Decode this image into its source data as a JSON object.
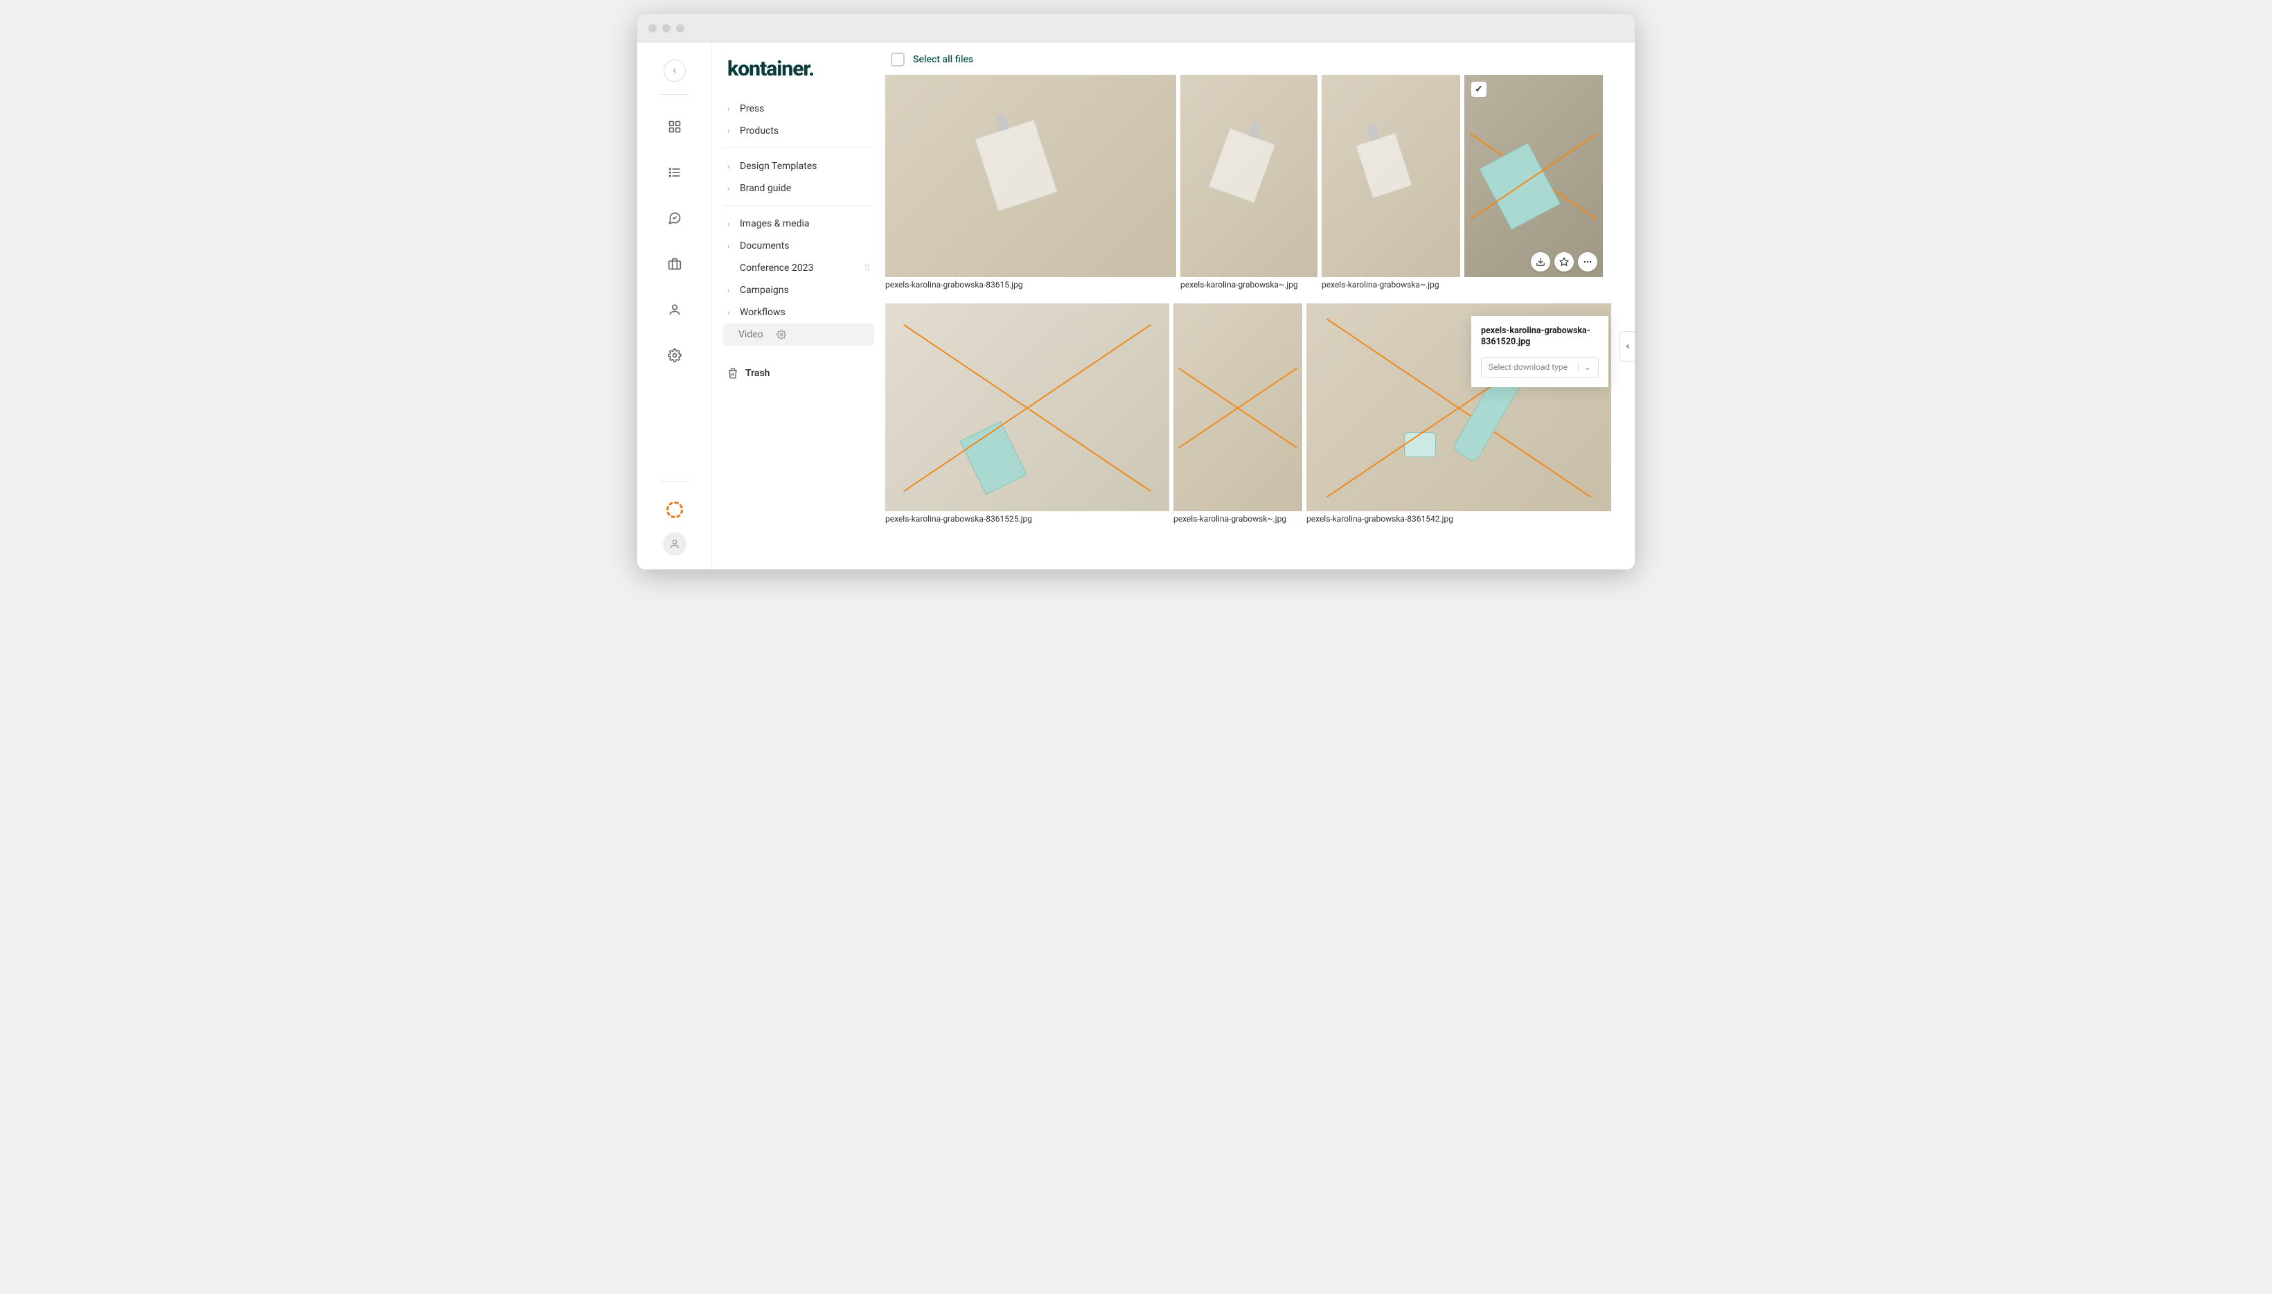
{
  "logo": "kontainer.",
  "toolbar": {
    "select_all": "Select all files"
  },
  "sidebar": {
    "groups": [
      {
        "items": [
          {
            "label": "Press"
          },
          {
            "label": "Products"
          }
        ]
      },
      {
        "items": [
          {
            "label": "Design Templates"
          },
          {
            "label": "Brand guide"
          }
        ]
      },
      {
        "items": [
          {
            "label": "Images & media"
          },
          {
            "label": "Documents"
          },
          {
            "label": "Conference 2023",
            "plain": true,
            "drag": true
          },
          {
            "label": "Campaigns"
          },
          {
            "label": "Workflows"
          },
          {
            "label": "Video",
            "active": true,
            "gear": true
          }
        ]
      }
    ],
    "trash": "Trash"
  },
  "files": [
    {
      "name": "pexels-karolina-grabowska-83615.jpg",
      "crossed": false,
      "shape": "clear"
    },
    {
      "name": "pexels-karolina-grabowska~.jpg",
      "crossed": false,
      "shape": "clear"
    },
    {
      "name": "pexels-karolina-grabowska~.jpg",
      "crossed": false,
      "shape": "clear"
    },
    {
      "name": "pexels-karolina-grabowska-8361520.jpg",
      "crossed": true,
      "shape": "mint",
      "selected": true,
      "actions": true
    },
    {
      "name": "pexels-karolina-grabowska-8361525.jpg",
      "crossed": true,
      "shape": "mint"
    },
    {
      "name": "pexels-karolina-grabowsk~.jpg",
      "crossed": true,
      "shape": "none"
    },
    {
      "name": "pexels-karolina-grabowska-8361542.jpg",
      "crossed": true,
      "shape": "mint-bottle"
    }
  ],
  "popover": {
    "filename": "pexels-karolina-grabowska-8361520.jpg",
    "select_placeholder": "Select download type"
  }
}
